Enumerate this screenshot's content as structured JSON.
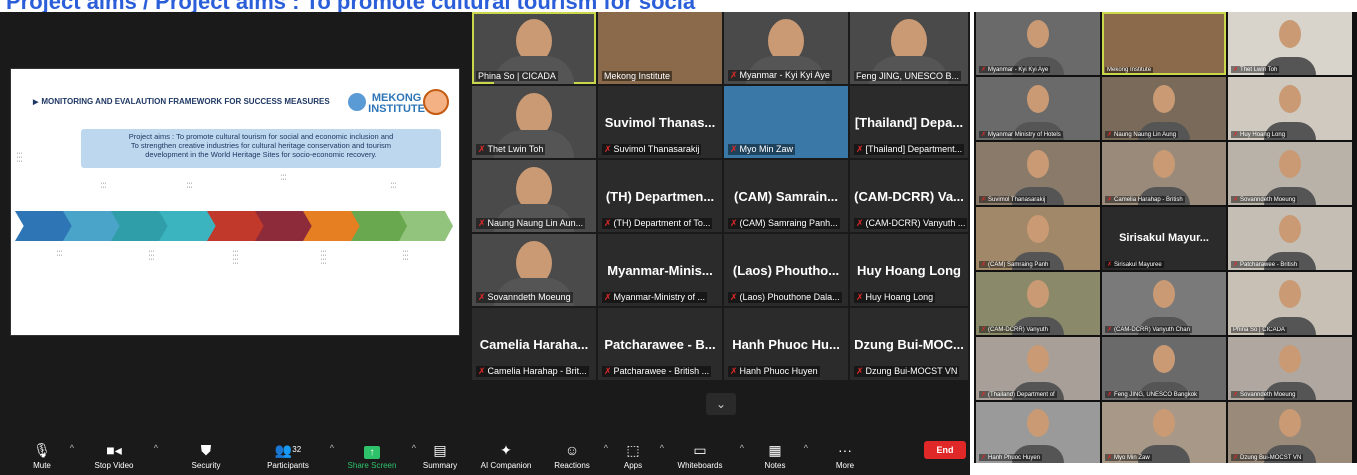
{
  "overlay": {
    "headline": "Project aims / Project aims : To promote cultural tourism for socia"
  },
  "share": {
    "title": "MONITORING AND EVALAUTION FRAMEWORK FOR SUCCESS MEASURES",
    "logo_line1": "MEKONG",
    "logo_line2": "INSTITUTE",
    "aims_line1": "Project aims : To promote cultural tourism for social and economic inclusion and",
    "aims_line2": "To strengthen creative industries for cultural heritage conservation and tourism",
    "aims_line3": "development in the World Heritage Sites for socio-economic recovery."
  },
  "gallery": {
    "row1": [
      {
        "name": "Phina So | CICADA"
      },
      {
        "name": "Mekong Institute"
      },
      {
        "name": "Myanmar - Kyi Kyi Aye"
      },
      {
        "name": "Feng JING, UNESCO B..."
      }
    ],
    "row2": [
      {
        "name": "Thet Lwin Toh"
      },
      {
        "big": "Suvimol Thanas...",
        "name": "Suvimol Thanasarakij"
      },
      {
        "name": "Myo Min Zaw"
      },
      {
        "big": "[Thailand] Depa...",
        "name": "[Thailand] Department..."
      }
    ],
    "row3": [
      {
        "name": "Naung Naung Lin Aun..."
      },
      {
        "big": "(TH) Departmen...",
        "name": "(TH) Department of To..."
      },
      {
        "big": "(CAM) Samrain...",
        "name": "(CAM) Samraing Panh..."
      },
      {
        "big": "(CAM-DCRR) Va...",
        "name": "(CAM-DCRR) Vanyuth ..."
      }
    ],
    "row4": [
      {
        "name": "Sovanndeth Moeung"
      },
      {
        "big": "Myanmar-Minis...",
        "name": "Myanmar-Ministry of ..."
      },
      {
        "big": "(Laos) Phoutho...",
        "name": "(Laos) Phouthone Dala..."
      },
      {
        "big": "Huy Hoang Long",
        "name": "Huy Hoang Long"
      }
    ],
    "row5": [
      {
        "big": "Camelia Haraha...",
        "name": "Camelia Harahap - Brit..."
      },
      {
        "big": "Patcharawee - B...",
        "name": "Patcharawee - British ..."
      },
      {
        "big": "Hanh Phuoc Hu...",
        "name": "Hanh Phuoc Huyen"
      },
      {
        "big": "Dzung Bui-MOC...",
        "name": "Dzung Bui-MOCST VN"
      }
    ]
  },
  "toolbar": {
    "mute": "Mute",
    "stop_video": "Stop Video",
    "security": "Security",
    "participants": "Participants",
    "participants_count": "32",
    "share_screen": "Share Screen",
    "summary": "Summary",
    "ai_companion": "AI Companion",
    "reactions": "Reactions",
    "apps": "Apps",
    "whiteboards": "Whiteboards",
    "notes": "Notes",
    "more": "More",
    "end": "End"
  },
  "right_gallery": [
    {
      "name": "Myanmar - Kyi Kyi Aye"
    },
    {
      "name": "Mekong Institute"
    },
    {
      "name": "Thet Lwin Toh"
    },
    {
      "name": "Myanmar Ministry of Hotels"
    },
    {
      "name": "Naung Naung Lin Aung"
    },
    {
      "name": "Huy Hoang Long"
    },
    {
      "name": "Suvimol Thanasarakij"
    },
    {
      "name": "Camelia Harahap - British"
    },
    {
      "name": "Sovanndeth Moeung"
    },
    {
      "name": "(CAM) Samraing Panh"
    },
    {
      "name": "Sirisakul Mayuree",
      "big": "Sirisakul Mayur..."
    },
    {
      "name": "Patcharawee - British"
    },
    {
      "name": "(CAM-DCRR) Vanyuth"
    },
    {
      "name": "(CAM-DCRR) Vanyuth Chan"
    },
    {
      "name": "Phina So | CICADA"
    },
    {
      "name": "(Thailand) Department of"
    },
    {
      "name": "Feng JING, UNESCO Bangkok"
    },
    {
      "name": "Sovanndeth Moeung"
    },
    {
      "name": "Hanh Phuoc Huyen"
    },
    {
      "name": "Myo Min Zaw"
    },
    {
      "name": "Dzung Bui-MOCST VN"
    }
  ]
}
